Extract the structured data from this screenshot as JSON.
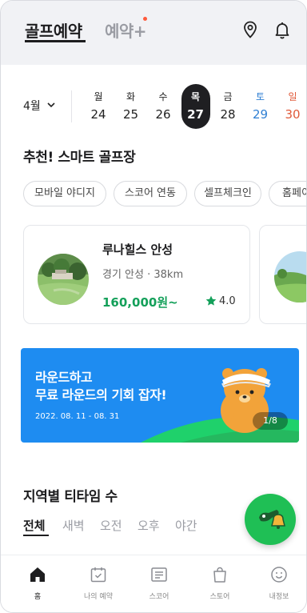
{
  "header": {
    "tab_active": "골프예약",
    "tab_other": "예약+",
    "icons": [
      "location-pin-icon",
      "bell-icon"
    ]
  },
  "date_picker": {
    "month": "4월",
    "days": [
      {
        "dow": "월",
        "num": "24",
        "state": "normal"
      },
      {
        "dow": "화",
        "num": "25",
        "state": "normal"
      },
      {
        "dow": "수",
        "num": "26",
        "state": "normal"
      },
      {
        "dow": "목",
        "num": "27",
        "state": "selected"
      },
      {
        "dow": "금",
        "num": "28",
        "state": "normal"
      },
      {
        "dow": "토",
        "num": "29",
        "state": "saturday"
      },
      {
        "dow": "일",
        "num": "30",
        "state": "sunday"
      }
    ]
  },
  "recommend": {
    "title": "추천! 스마트 골프장",
    "chips": [
      "모바일 야디지",
      "스코어 연동",
      "셀프체크인",
      "홈페이"
    ],
    "cards": [
      {
        "name": "루나힐스 안성",
        "location": "경기 안성 · 38km",
        "price": "160,000원~",
        "rating": "4.0"
      }
    ]
  },
  "banner": {
    "line1": "라운드하고",
    "line2": "무료 라운드의 기회 잡자!",
    "date": "2022. 08. 11 - 08. 31",
    "page": "1/8"
  },
  "region": {
    "title": "지역별 티타임 수",
    "filters": [
      "전체",
      "새벽",
      "오전",
      "오후",
      "야간"
    ]
  },
  "nav": {
    "items": [
      {
        "label": "홈",
        "icon": "home-icon"
      },
      {
        "label": "나의 예약",
        "icon": "calendar-check-icon"
      },
      {
        "label": "스코어",
        "icon": "scorecard-icon"
      },
      {
        "label": "스토어",
        "icon": "shopping-bag-icon"
      },
      {
        "label": "내정보",
        "icon": "smiley-face-icon"
      }
    ]
  },
  "colors": {
    "accent_green": "#14a05a",
    "banner_blue": "#1e8cf1",
    "saturday_blue": "#2f7fd3",
    "sunday_red": "#e05a3a",
    "selected_dark": "#1f1f22",
    "header_bg": "#f1f2f5"
  }
}
